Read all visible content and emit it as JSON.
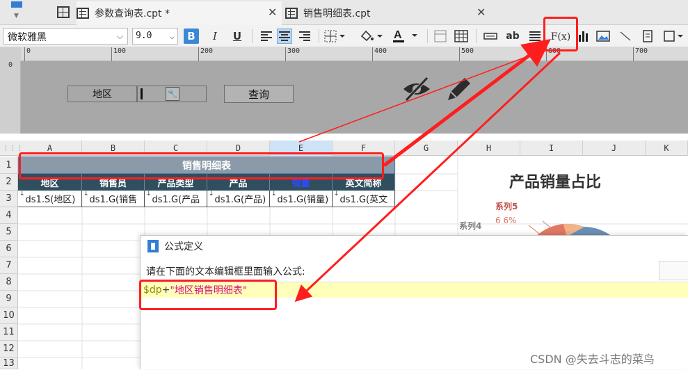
{
  "tabs": [
    {
      "label": "参数查询表.cpt *",
      "active": true
    },
    {
      "label": "销售明细表.cpt",
      "active": false
    }
  ],
  "toolbar": {
    "font_name": "微软雅黑",
    "font_size": "9.0",
    "bold": "B",
    "italic": "I",
    "underline": "U",
    "text_label": "ab",
    "formula_button": "F(x)"
  },
  "ruler": {
    "ticks": [
      "0",
      "100",
      "200",
      "300",
      "400",
      "500",
      "600",
      "700"
    ],
    "vertical_zero": "0"
  },
  "parameter_panel": {
    "label": "地区",
    "query_button": "查询"
  },
  "grid": {
    "columns": [
      "A",
      "B",
      "C",
      "D",
      "E",
      "F",
      "G",
      "H",
      "I",
      "J",
      "K"
    ],
    "rows": [
      "1",
      "2",
      "3",
      "4",
      "5",
      "6",
      "7",
      "8",
      "9",
      "10",
      "11",
      "12",
      "13"
    ],
    "title_cell": "销售明细表",
    "headers": [
      "地区",
      "销售员",
      "产品类型",
      "产品",
      "销量",
      "英文简称"
    ],
    "data_row": [
      "ds1.S(地区)",
      "ds1.G(销售",
      "ds1.G(产品",
      "ds1.G(产品)",
      "ds1.G(销量)",
      "ds1.G(英文"
    ]
  },
  "chart": {
    "title": "产品销量占比",
    "labels": [
      "系列5",
      "6 6%",
      "系列4"
    ]
  },
  "dialog": {
    "title": "公式定义",
    "prompt": "请在下面的文本编辑框里面输入公式:",
    "formula_var": "$dp",
    "formula_op": "+",
    "formula_str": "\"地区销售明细表\""
  },
  "colors": {
    "accent_blue": "#3c87d6",
    "annotation_red": "#ff1e1e",
    "header_dark": "#2f4f5f",
    "formula_highlight": "#ffffbb"
  },
  "watermark": "CSDN @失去斗志的菜鸟"
}
